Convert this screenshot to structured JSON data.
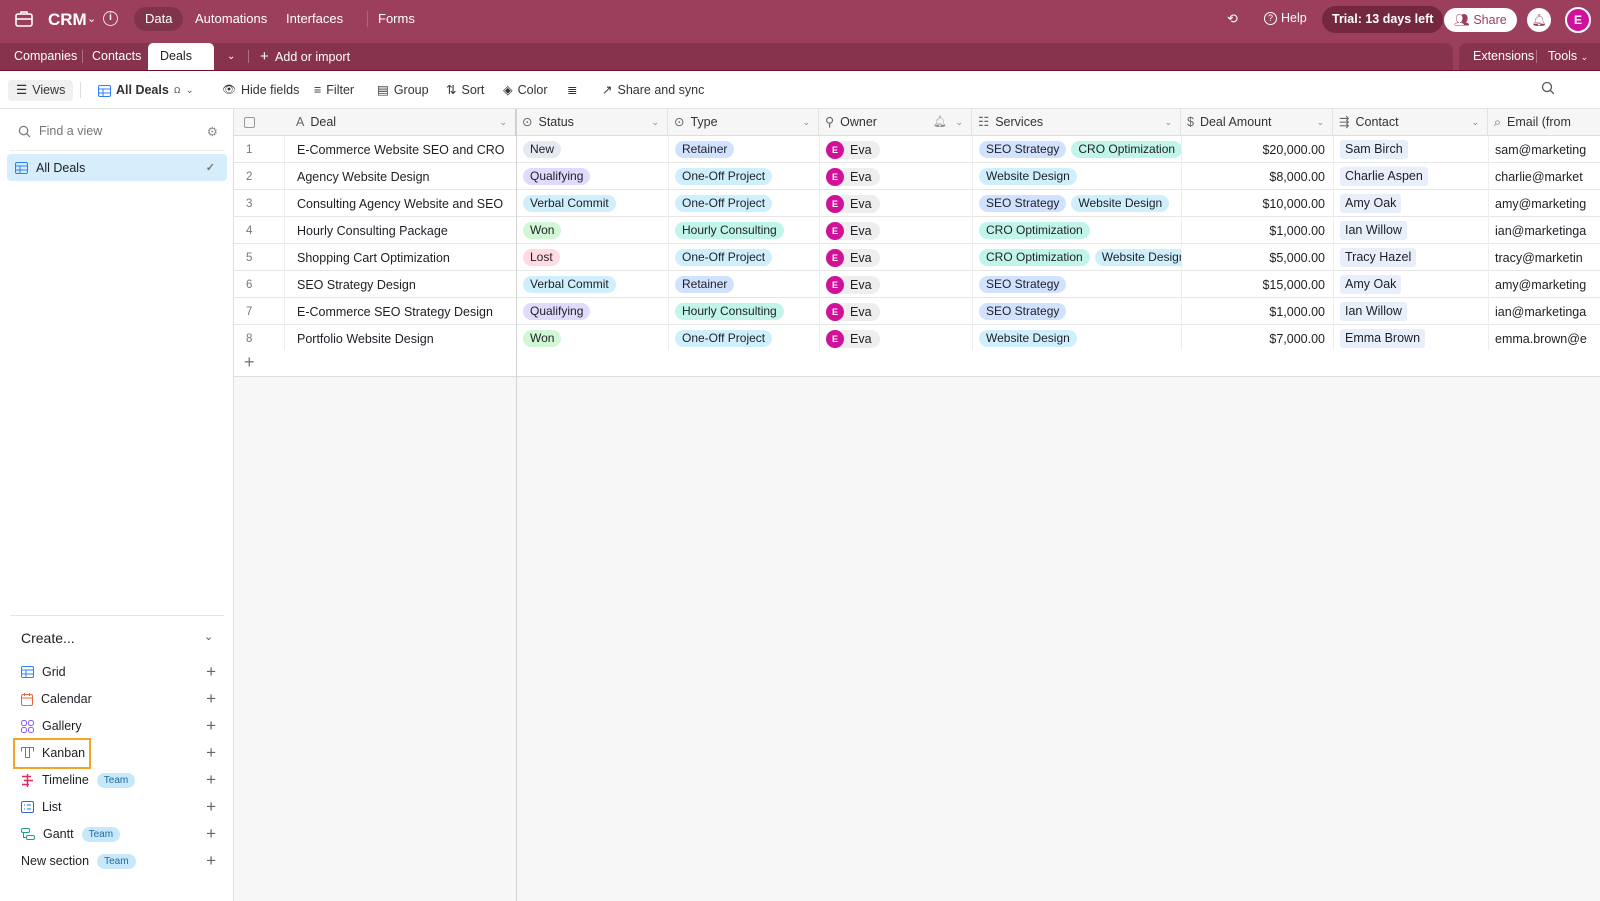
{
  "app": {
    "name": "CRM",
    "nav_tabs": [
      "Data",
      "Automations",
      "Interfaces",
      "Forms"
    ],
    "active_nav": "Data",
    "help_label": "Help",
    "trial_label": "Trial: 13 days left",
    "share_label": "Share",
    "user_initial": "E",
    "brand_color": "#9b3f5c"
  },
  "tables": {
    "tabs": [
      "Companies",
      "Contacts",
      "Deals"
    ],
    "active": "Deals",
    "add_label": "Add or import",
    "extensions_label": "Extensions",
    "tools_label": "Tools"
  },
  "toolbar": {
    "views_label": "Views",
    "view_name": "All Deals",
    "hide_fields": "Hide fields",
    "filter": "Filter",
    "group": "Group",
    "sort": "Sort",
    "color": "Color",
    "share_sync": "Share and sync"
  },
  "sidebar": {
    "find_placeholder": "Find a view",
    "views": [
      {
        "name": "All Deals",
        "selected": true
      }
    ],
    "create_heading": "Create...",
    "create_items": [
      {
        "label": "Grid",
        "icon": "grid-icon",
        "badge": null
      },
      {
        "label": "Calendar",
        "icon": "calendar-icon",
        "badge": null
      },
      {
        "label": "Gallery",
        "icon": "gallery-icon",
        "badge": null
      },
      {
        "label": "Kanban",
        "icon": "kanban-icon",
        "badge": null,
        "highlighted": true
      },
      {
        "label": "Timeline",
        "icon": "timeline-icon",
        "badge": "Team"
      },
      {
        "label": "List",
        "icon": "list-icon",
        "badge": null
      },
      {
        "label": "Gantt",
        "icon": "gantt-icon",
        "badge": "Team"
      },
      {
        "label": "New section",
        "icon": null,
        "badge": "Team"
      }
    ]
  },
  "grid": {
    "columns": [
      "Deal",
      "Status",
      "Type",
      "Owner",
      "Services",
      "Deal Amount",
      "Contact",
      "Email (from"
    ],
    "pill_colors": {
      "New": "#e5e9f0",
      "Qualifying": "#e0dafd",
      "Verbal Commit": "#cfeffd",
      "Won": "#d1f7d4",
      "Lost": "#ffdae2",
      "Retainer": "#d1e2ff",
      "One-Off Project": "#cfeffd",
      "Hourly Consulting": "#c2f5e9",
      "SEO Strategy": "#d1e2ff",
      "CRO Optimization": "#c2f5e9",
      "Website Design": "#cfeffd"
    },
    "rows": [
      {
        "num": "1",
        "deal": "E-Commerce Website SEO and CRO",
        "status": "New",
        "type": "Retainer",
        "owner": "Eva",
        "services": [
          "SEO Strategy",
          "CRO Optimization"
        ],
        "amount": "$20,000.00",
        "contact": "Sam Birch",
        "email": "sam@marketing"
      },
      {
        "num": "2",
        "deal": "Agency Website Design",
        "status": "Qualifying",
        "type": "One-Off Project",
        "owner": "Eva",
        "services": [
          "Website Design"
        ],
        "amount": "$8,000.00",
        "contact": "Charlie Aspen",
        "email": "charlie@market"
      },
      {
        "num": "3",
        "deal": "Consulting Agency Website and SEO",
        "status": "Verbal Commit",
        "type": "One-Off Project",
        "owner": "Eva",
        "services": [
          "SEO Strategy",
          "Website Design"
        ],
        "amount": "$10,000.00",
        "contact": "Amy Oak",
        "email": "amy@marketing"
      },
      {
        "num": "4",
        "deal": "Hourly Consulting Package",
        "status": "Won",
        "type": "Hourly Consulting",
        "owner": "Eva",
        "services": [
          "CRO Optimization"
        ],
        "amount": "$1,000.00",
        "contact": "Ian Willow",
        "email": "ian@marketinga"
      },
      {
        "num": "5",
        "deal": "Shopping Cart Optimization",
        "status": "Lost",
        "type": "One-Off Project",
        "owner": "Eva",
        "services": [
          "CRO Optimization",
          "Website Design"
        ],
        "amount": "$5,000.00",
        "contact": "Tracy Hazel",
        "email": "tracy@marketin"
      },
      {
        "num": "6",
        "deal": "SEO Strategy Design",
        "status": "Verbal Commit",
        "type": "Retainer",
        "owner": "Eva",
        "services": [
          "SEO Strategy"
        ],
        "amount": "$15,000.00",
        "contact": "Amy Oak",
        "email": "amy@marketing"
      },
      {
        "num": "7",
        "deal": "E-Commerce SEO Strategy Design",
        "status": "Qualifying",
        "type": "Hourly Consulting",
        "owner": "Eva",
        "services": [
          "SEO Strategy"
        ],
        "amount": "$1,000.00",
        "contact": "Ian Willow",
        "email": "ian@marketinga"
      },
      {
        "num": "8",
        "deal": "Portfolio Website Design",
        "status": "Won",
        "type": "One-Off Project",
        "owner": "Eva",
        "services": [
          "Website Design"
        ],
        "amount": "$7,000.00",
        "contact": "Emma Brown",
        "email": "emma.brown@e"
      }
    ]
  }
}
